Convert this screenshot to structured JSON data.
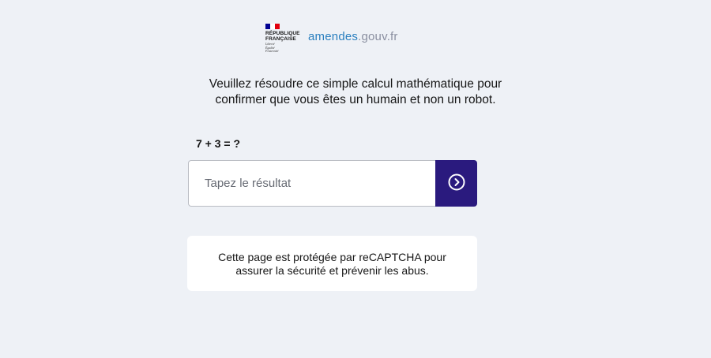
{
  "header": {
    "republic_line1": "RÉPUBLIQUE",
    "republic_line2": "FRANÇAISE",
    "devise_1": "Liberté",
    "devise_2": "Égalité",
    "devise_3": "Fraternité",
    "site_name_main": "amendes",
    "site_name_suffix": ".gouv.fr"
  },
  "captcha": {
    "instruction_line1": "Veuillez résoudre ce simple calcul mathématique pour",
    "instruction_line2": "confirmer que vous êtes un humain et non un robot.",
    "question": "7 + 3 = ?",
    "input_placeholder": "Tapez le résultat",
    "input_value": "",
    "submit_icon": "chevron-right-circle-icon"
  },
  "recaptcha_note": {
    "line1": "Cette page est protégée par reCAPTCHA pour",
    "line2": "assurer la sécurité et prévenir les abus."
  },
  "colors": {
    "background": "#eef1f6",
    "submit_button": "#2a1a7e",
    "site_name": "#2a7fbf",
    "flag_blue": "#000091",
    "flag_red": "#e1000f"
  }
}
